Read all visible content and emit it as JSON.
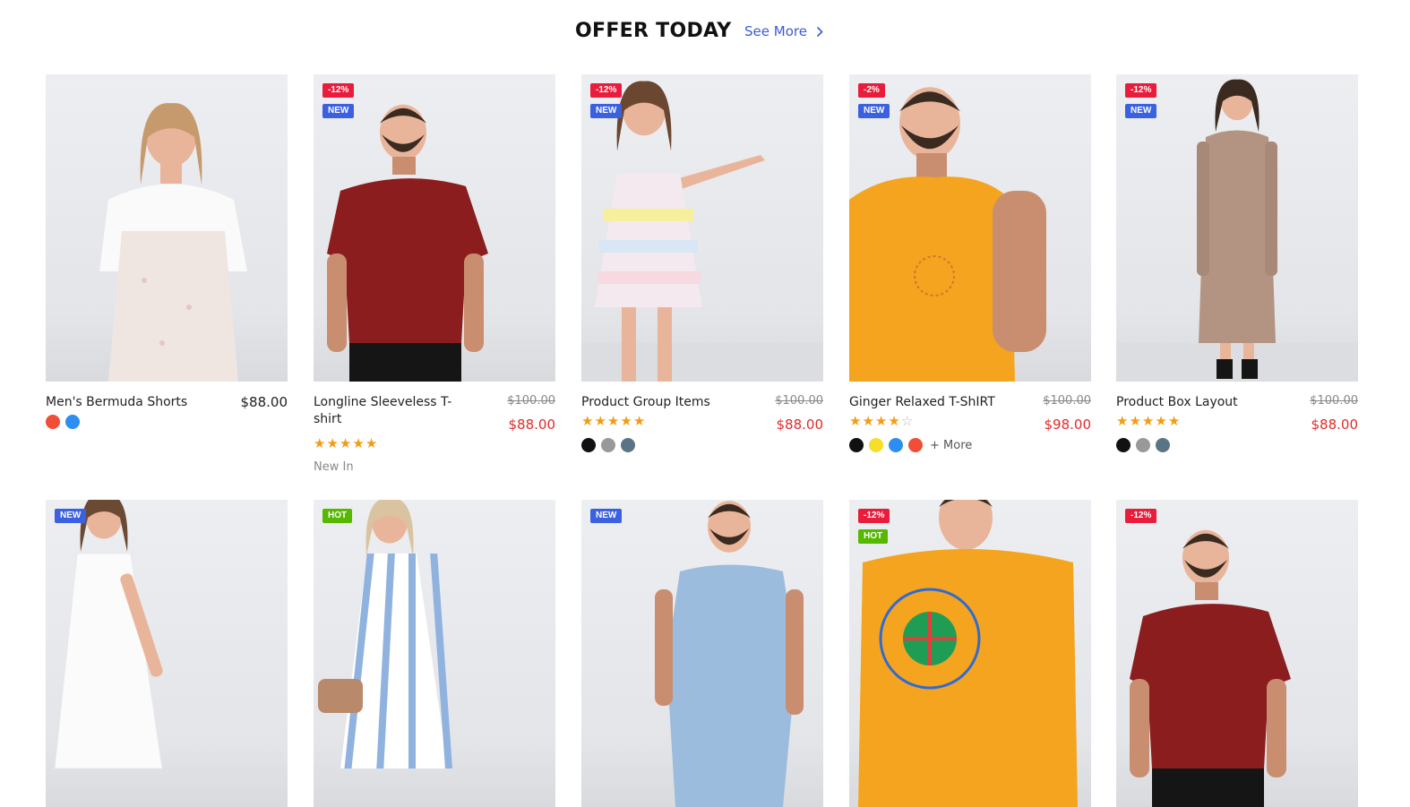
{
  "section": {
    "title": "OFFER TODAY",
    "see_more_label": "See More"
  },
  "products": [
    {
      "name": "Men's Bermuda Shorts",
      "price": "$88.00",
      "old_price": "",
      "badges": [],
      "rating": 0,
      "swatches": [
        "#f04e37",
        "#2b8ef0"
      ],
      "more_colors": "",
      "tag": "",
      "image": "woman-white-dungaree-dress"
    },
    {
      "name": "Longline Sleeveless T-shirt",
      "price": "$88.00",
      "old_price": "$100.00",
      "badges": [
        {
          "text": "-12%",
          "type": "sale"
        },
        {
          "text": "NEW",
          "type": "new"
        }
      ],
      "rating": 5,
      "swatches": [],
      "more_colors": "",
      "tag": "New In",
      "image": "man-red-tshirt"
    },
    {
      "name": "Product Group Items",
      "price": "$88.00",
      "old_price": "$100.00",
      "badges": [
        {
          "text": "-12%",
          "type": "sale"
        },
        {
          "text": "NEW",
          "type": "new"
        }
      ],
      "rating": 5,
      "swatches": [
        "#111111",
        "#999999",
        "#5a7485"
      ],
      "more_colors": "",
      "tag": "",
      "image": "woman-pastel-tulle-dress"
    },
    {
      "name": "Ginger Relaxed T-ShIRT",
      "price": "$98.00",
      "old_price": "$100.00",
      "badges": [
        {
          "text": "-2%",
          "type": "sale"
        },
        {
          "text": "NEW",
          "type": "new"
        }
      ],
      "rating": 4,
      "swatches": [
        "#111111",
        "#f7de2a",
        "#2b8ef0",
        "#f04e37"
      ],
      "more_colors": "+ More",
      "tag": "",
      "image": "man-orange-tank"
    },
    {
      "name": "Product Box Layout",
      "price": "$88.00",
      "old_price": "$100.00",
      "badges": [
        {
          "text": "-12%",
          "type": "sale"
        },
        {
          "text": "NEW",
          "type": "new"
        }
      ],
      "rating": 5,
      "swatches": [
        "#111111",
        "#999999",
        "#5a7485"
      ],
      "more_colors": "",
      "tag": "",
      "image": "woman-beige-knit-dress"
    },
    {
      "name": "",
      "price": "",
      "old_price": "",
      "badges": [
        {
          "text": "NEW",
          "type": "new"
        }
      ],
      "rating": 0,
      "swatches": [],
      "more_colors": "",
      "tag": "",
      "image": "woman-white-slip-dress"
    },
    {
      "name": "",
      "price": "",
      "old_price": "",
      "badges": [
        {
          "text": "HOT",
          "type": "hot"
        }
      ],
      "rating": 0,
      "swatches": [],
      "more_colors": "",
      "tag": "",
      "image": "woman-striped-dress"
    },
    {
      "name": "",
      "price": "",
      "old_price": "",
      "badges": [
        {
          "text": "NEW",
          "type": "new"
        }
      ],
      "rating": 0,
      "swatches": [],
      "more_colors": "",
      "tag": "",
      "image": "man-denim-jumpsuit"
    },
    {
      "name": "",
      "price": "",
      "old_price": "",
      "badges": [
        {
          "text": "-12%",
          "type": "sale"
        },
        {
          "text": "HOT",
          "type": "hot"
        }
      ],
      "rating": 0,
      "swatches": [],
      "more_colors": "",
      "tag": "",
      "image": "man-orange-tank-back-print"
    },
    {
      "name": "",
      "price": "",
      "old_price": "",
      "badges": [
        {
          "text": "-12%",
          "type": "sale"
        }
      ],
      "rating": 0,
      "swatches": [],
      "more_colors": "",
      "tag": "",
      "image": "man-red-tshirt"
    }
  ],
  "colors": {
    "accent_link": "#3b5bdb",
    "sale_price": "#e02b2b",
    "star": "#f39c12",
    "badge_sale": "#ea1c3b",
    "badge_new": "#3b61e0",
    "badge_hot": "#57b800"
  }
}
